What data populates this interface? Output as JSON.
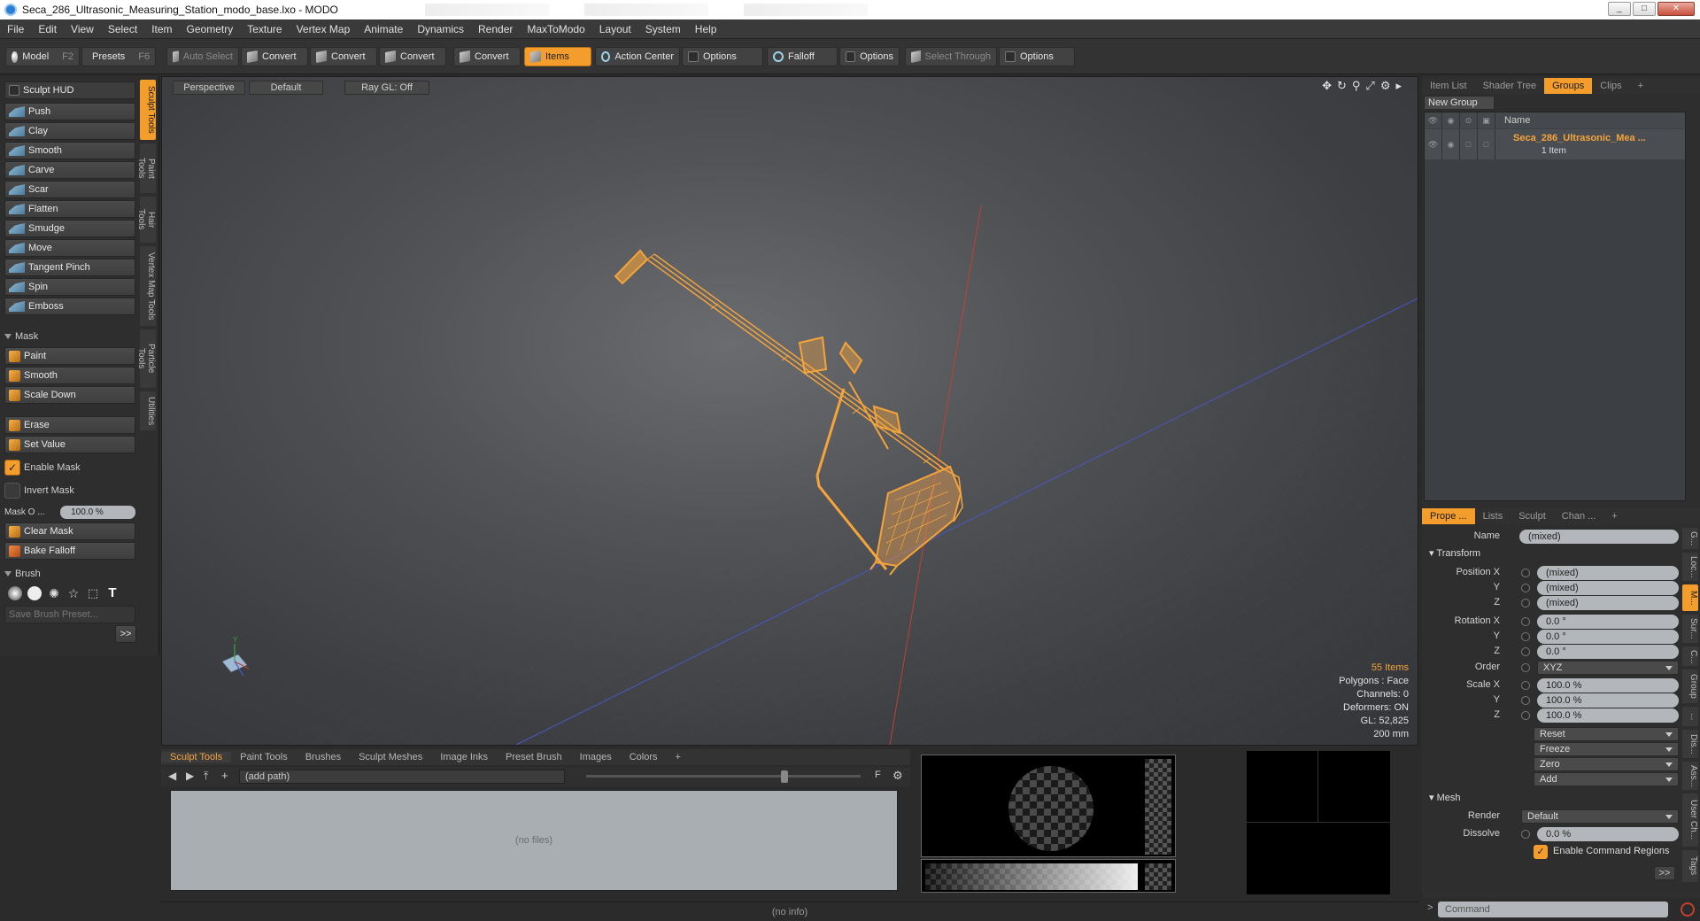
{
  "window": {
    "title": "Seca_286_Ultrasonic_Measuring_Station_modo_base.lxo - MODO"
  },
  "menu": [
    "File",
    "Edit",
    "View",
    "Select",
    "Item",
    "Geometry",
    "Texture",
    "Vertex Map",
    "Animate",
    "Dynamics",
    "Render",
    "MaxToModo",
    "Layout",
    "System",
    "Help"
  ],
  "toolbar": {
    "model": "Model",
    "model_key": "F2",
    "presets": "Presets",
    "presets_key": "F6",
    "auto_select": "Auto Select",
    "convert1": "Convert",
    "convert2": "Convert",
    "convert3": "Convert",
    "convert4": "Convert",
    "items": "Items",
    "action_center": "Action Center",
    "options1": "Options",
    "falloff": "Falloff",
    "options2": "Options",
    "select_through": "Select Through",
    "options3": "Options"
  },
  "left": {
    "sculpt_hud": "Sculpt HUD",
    "tools": [
      "Push",
      "Clay",
      "Smooth",
      "Carve",
      "Scar",
      "Flatten",
      "Smudge",
      "Move",
      "Tangent Pinch",
      "Spin",
      "Emboss"
    ],
    "mask_section": "Mask",
    "mask_tools": [
      "Paint",
      "Smooth",
      "Scale Down"
    ],
    "erase": "Erase",
    "set_value": "Set Value",
    "enable_mask": "Enable Mask",
    "invert_mask": "Invert Mask",
    "mask_opacity_label": "Mask O ...",
    "mask_opacity_value": "100.0 %",
    "clear_mask": "Clear Mask",
    "bake_falloff": "Bake Falloff",
    "brush_section": "Brush",
    "save_brush_preset": "Save Brush Preset...",
    "more": ">>",
    "vtabs": [
      "Sculpt Tools",
      "Paint Tools",
      "Hair Tools",
      "Vertex Map Tools",
      "Particle Tools",
      "Utilities"
    ]
  },
  "viewport": {
    "view": "Perspective",
    "shading": "Default",
    "raygl": "Ray GL: Off",
    "info": {
      "items": "55 Items",
      "polygons": "Polygons : Face",
      "channels": "Channels: 0",
      "deformers": "Deformers: ON",
      "gl": "GL: 52,825",
      "scale": "200 mm"
    }
  },
  "bottom": {
    "tabs": [
      "Sculpt Tools",
      "Paint Tools",
      "Brushes",
      "Sculpt Meshes",
      "Image Inks",
      "Preset Brush",
      "Images",
      "Colors",
      "+"
    ],
    "path": "(add path)",
    "no_files": "(no files)",
    "status": "(no info)"
  },
  "right": {
    "top_tabs": [
      "Item List",
      "Shader Tree",
      "Groups",
      "Clips",
      "+"
    ],
    "new_group": "New Group",
    "name_header": "Name",
    "group_name": "Seca_286_Ultrasonic_Mea ...",
    "group_count": "1 Item",
    "prop_tabs": [
      "Prope ...",
      "Lists",
      "Sculpt",
      "Chan ...",
      "+"
    ],
    "name_label": "Name",
    "name_value": "(mixed)",
    "transform": "Transform",
    "position_x_label": "Position X",
    "position_x": "(mixed)",
    "position_y_label": "Y",
    "position_y": "(mixed)",
    "position_z_label": "Z",
    "position_z": "(mixed)",
    "rotation_x_label": "Rotation X",
    "rotation_x": "0.0 °",
    "rotation_y_label": "Y",
    "rotation_y": "0.0 °",
    "rotation_z_label": "Z",
    "rotation_z": "0.0 °",
    "order_label": "Order",
    "order": "XYZ",
    "scale_x_label": "Scale X",
    "scale_x": "100.0 %",
    "scale_y_label": "Y",
    "scale_y": "100.0 %",
    "scale_z_label": "Z",
    "scale_z": "100.0 %",
    "reset": "Reset",
    "freeze": "Freeze",
    "zero": "Zero",
    "add": "Add",
    "mesh": "Mesh",
    "render_label": "Render",
    "render": "Default",
    "dissolve_label": "Dissolve",
    "dissolve": "0.0 %",
    "enable_command_regions": "Enable Command Regions",
    "more": ">>",
    "command_placeholder": "Command",
    "side_vtabs": [
      "G...",
      "Loc...",
      "M...",
      "Sur...",
      "C...",
      "Group",
      "...",
      "Dis...",
      "Ass...",
      "User Ch...",
      "Tags"
    ]
  },
  "colors": {
    "accent": "#f29d2c",
    "wireframe": "#f5a43a"
  }
}
